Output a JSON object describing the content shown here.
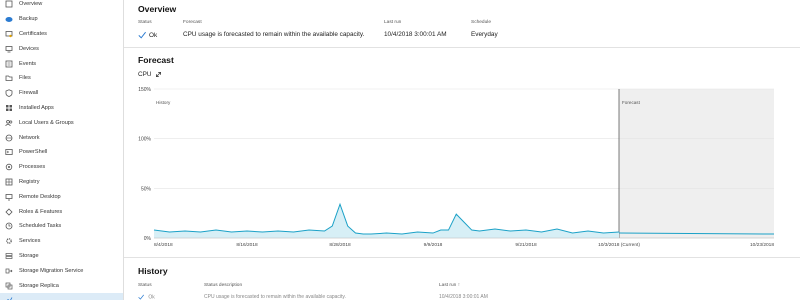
{
  "sidebar": {
    "items": [
      {
        "label": "Overview",
        "icon": "overview-icon"
      },
      {
        "label": "Backup",
        "icon": "backup-icon"
      },
      {
        "label": "Certificates",
        "icon": "certificate-icon"
      },
      {
        "label": "Devices",
        "icon": "devices-icon"
      },
      {
        "label": "Events",
        "icon": "events-icon"
      },
      {
        "label": "Files",
        "icon": "folder-icon"
      },
      {
        "label": "Firewall",
        "icon": "firewall-icon"
      },
      {
        "label": "Installed Apps",
        "icon": "apps-icon"
      },
      {
        "label": "Local Users & Groups",
        "icon": "users-icon"
      },
      {
        "label": "Network",
        "icon": "network-icon"
      },
      {
        "label": "PowerShell",
        "icon": "powershell-icon"
      },
      {
        "label": "Processes",
        "icon": "processes-icon"
      },
      {
        "label": "Registry",
        "icon": "registry-icon"
      },
      {
        "label": "Remote Desktop",
        "icon": "remote-desktop-icon"
      },
      {
        "label": "Roles & Features",
        "icon": "roles-icon"
      },
      {
        "label": "Scheduled Tasks",
        "icon": "scheduled-tasks-icon"
      },
      {
        "label": "Services",
        "icon": "services-icon"
      },
      {
        "label": "Storage",
        "icon": "storage-icon"
      },
      {
        "label": "Storage Migration Service",
        "icon": "migration-icon"
      },
      {
        "label": "Storage Replica",
        "icon": "replica-icon"
      },
      {
        "label": "",
        "icon": "system-insights-icon"
      }
    ]
  },
  "overview": {
    "title": "Overview",
    "status_header": "Status",
    "status_value": "Ok",
    "forecast_header": "Forecast",
    "forecast_value": "CPU usage is forecasted to remain within the available capacity.",
    "lastrun_header": "Last run",
    "lastrun_value": "10/4/2018 3:00:01 AM",
    "schedule_header": "Schedule",
    "schedule_value": "Everyday"
  },
  "forecast": {
    "title": "Forecast",
    "chart_label": "CPU"
  },
  "chart_data": {
    "type": "area",
    "title": "",
    "ylim": [
      0,
      150
    ],
    "yticks": [
      "0%",
      "50%",
      "100%",
      "150%"
    ],
    "ytick_values": [
      0,
      50,
      100,
      150
    ],
    "xlim": [
      0,
      80
    ],
    "xticks": [
      {
        "label": "8/4/2018",
        "x": 0
      },
      {
        "label": "8/16/2018",
        "x": 12
      },
      {
        "label": "8/28/2018",
        "x": 24
      },
      {
        "label": "9/9/2018",
        "x": 36
      },
      {
        "label": "9/21/2018",
        "x": 48
      },
      {
        "label": "10/3/2018 (Current)",
        "x": 60
      },
      {
        "label": "10/23/2018",
        "x": 80
      }
    ],
    "regions": {
      "history_label": "History",
      "forecast_label": "Forecast",
      "forecast_start_x": 60
    },
    "history": {
      "x": [
        0,
        2,
        4,
        6,
        8,
        10,
        12,
        14,
        16,
        18,
        20,
        22,
        23,
        24,
        25,
        26,
        27,
        28,
        30,
        32,
        34,
        36,
        37,
        38,
        39,
        40,
        41,
        42,
        44,
        46,
        48,
        50,
        52,
        54,
        56,
        58,
        60
      ],
      "y": [
        8,
        6,
        7,
        6,
        8,
        6,
        7,
        6,
        7,
        6,
        8,
        7,
        12,
        34,
        12,
        5,
        4,
        4,
        5,
        4,
        6,
        5,
        8,
        8,
        24,
        16,
        8,
        7,
        9,
        7,
        8,
        6,
        9,
        5,
        7,
        5,
        6
      ]
    },
    "forecast_series": {
      "x": [
        60,
        80
      ],
      "y": [
        5,
        4
      ]
    },
    "colors": {
      "line": "#1ba1c7",
      "fill": "#d7eff6",
      "forecast_bg": "#efefef",
      "grid": "#e4e4e4"
    }
  },
  "history": {
    "title": "History",
    "col_status": "Status",
    "col_desc": "Status description",
    "col_lastrun": "Last run",
    "row_status": "Ok",
    "row_desc": "CPU usage is forecasted to remain within the available capacity.",
    "row_lastrun": "10/4/2018 3:00:01 AM"
  }
}
